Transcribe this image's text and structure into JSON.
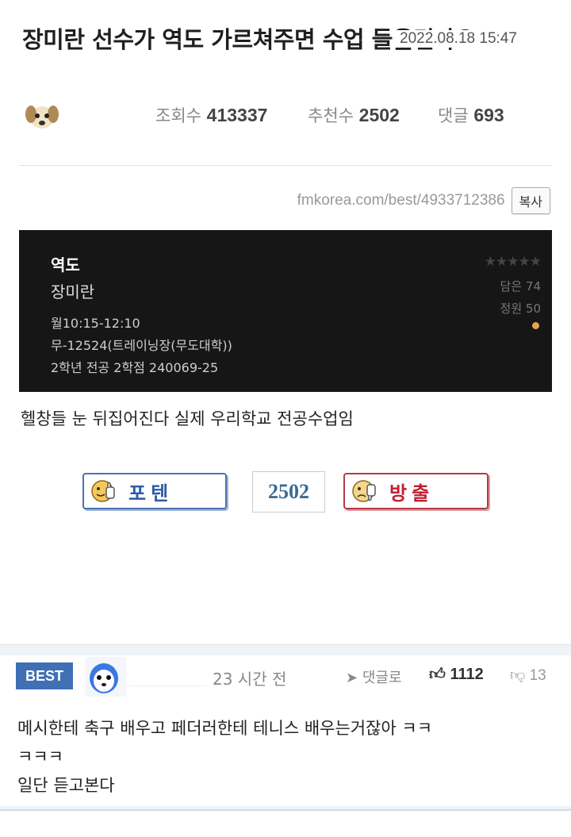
{
  "post": {
    "title": "장미란 선수가 역도 가르쳐주면 수업 들을건가요",
    "date": "2022.08.18 15:47",
    "views_label": "조회수",
    "views": "413337",
    "recommend_label": "추천수",
    "recommend": "2502",
    "comments_label": "댓글",
    "comments": "693",
    "url": "fmkorea.com/best/4933712386",
    "copy_label": "복사",
    "body": "헬창들 눈 뒤집어진다 실제 우리학교 전공수업임"
  },
  "course": {
    "name": "역도",
    "professor": "장미란",
    "time": "월10:15-12:10",
    "room": "무-12524(트레이닝장(무도대학))",
    "info": "2학년 전공 2학점 240069-25",
    "stars": "★★★★★",
    "enrolled": "담은 74",
    "capacity": "정원 50",
    "dot_color": "#e7a34a"
  },
  "vote": {
    "up_label": "포텐",
    "count": "2502",
    "down_label": "방출",
    "up_color": "#4a72b0",
    "down_color": "#b63a47"
  },
  "comment": {
    "badge": "BEST",
    "time": "23 시간 전",
    "reply_label": "댓글로",
    "likes": "1112",
    "dislikes": "13",
    "text_line1": "메시한테 축구 배우고 페더러한테 테니스 배우는거잖아 ㅋㅋ",
    "text_line2": "ㅋㅋㅋ",
    "text_line3": "일단 듣고본다"
  }
}
